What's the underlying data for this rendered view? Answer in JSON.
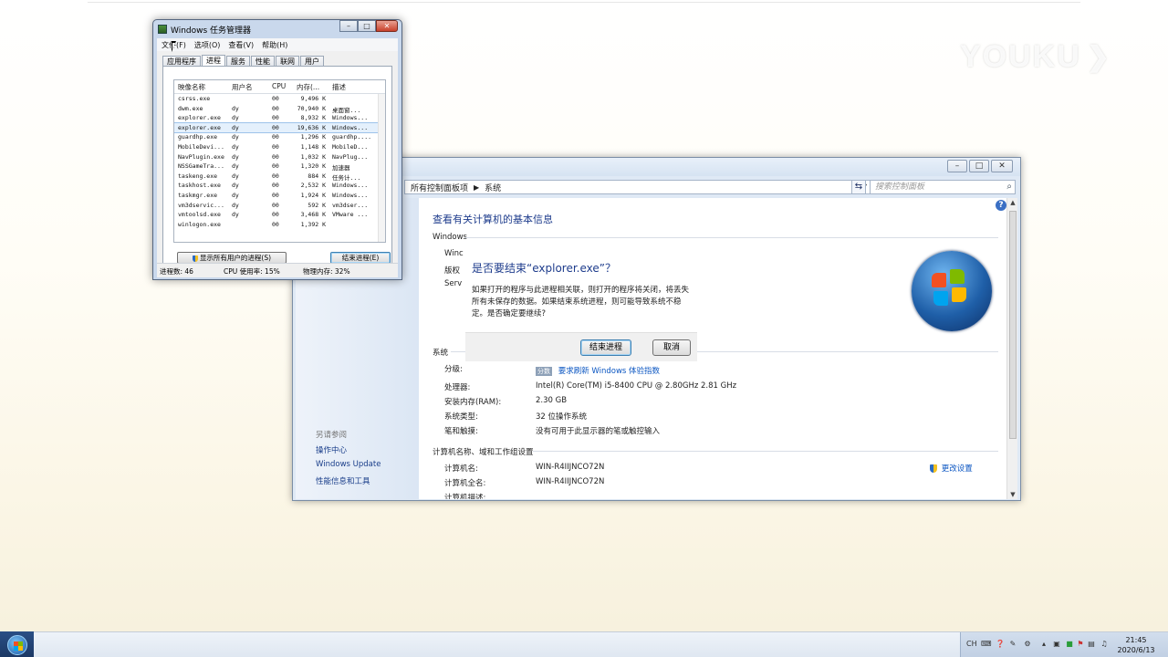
{
  "watermark": {
    "text": "YOUKU"
  },
  "system_window": {
    "address": {
      "segment1": "所有控制面板项",
      "segment2": "系统"
    },
    "search": {
      "placeholder": "搜索控制面板"
    },
    "page_title": "查看有关计算机的基本信息",
    "windows_edition_section": "Windows",
    "partial_labels": [
      "Winc",
      "版权",
      "Serv"
    ],
    "system_section": "系统",
    "rating": {
      "label": "分级:",
      "badge": "分数",
      "link": "要求刷新 Windows 体验指数"
    },
    "specs": [
      {
        "label": "处理器:",
        "value": "Intel(R) Core(TM) i5-8400 CPU @ 2.80GHz   2.81 GHz"
      },
      {
        "label": "安装内存(RAM):",
        "value": "2.30 GB"
      },
      {
        "label": "系统类型:",
        "value": "32 位操作系统"
      },
      {
        "label": "笔和触摸:",
        "value": "没有可用于此显示器的笔或触控输入"
      }
    ],
    "computer_section": "计算机名称、域和工作组设置",
    "computer": [
      {
        "label": "计算机名:",
        "value": "WIN-R4IIJNCO72N"
      },
      {
        "label": "计算机全名:",
        "value": "WIN-R4IIJNCO72N"
      },
      {
        "label": "计算机描述:",
        "value": ""
      }
    ],
    "change_settings": "更改设置",
    "left_pane": {
      "see_also": "另请参阅",
      "links": [
        "操作中心",
        "Windows Update",
        "性能信息和工具"
      ]
    }
  },
  "dialog": {
    "title": "是否要结束“explorer.exe”？",
    "message": "如果打开的程序与此进程相关联，则打开的程序将关闭，将丢失所有未保存的数据。如果结束系统进程，则可能导致系统不稳定。是否确定要继续?",
    "end_button": "结束进程",
    "cancel_button": "取消"
  },
  "task_manager": {
    "title": "Windows 任务管理器",
    "menus": [
      "文件(F)",
      "选项(O)",
      "查看(V)",
      "帮助(H)"
    ],
    "tabs": [
      "应用程序",
      "进程",
      "服务",
      "性能",
      "联网",
      "用户"
    ],
    "active_tab": 1,
    "columns": [
      "映像名称",
      "用户名",
      "CPU",
      "内存(...",
      "描述"
    ],
    "rows": [
      {
        "name": "csrss.exe",
        "user": "",
        "cpu": "00",
        "mem": "9,496 K",
        "desc": ""
      },
      {
        "name": "dwm.exe",
        "user": "dy",
        "cpu": "00",
        "mem": "70,940 K",
        "desc": "桌面窗..."
      },
      {
        "name": "explorer.exe",
        "user": "dy",
        "cpu": "00",
        "mem": "8,932 K",
        "desc": "Windows..."
      },
      {
        "name": "explorer.exe",
        "user": "dy",
        "cpu": "00",
        "mem": "19,636 K",
        "desc": "Windows...",
        "selected": true
      },
      {
        "name": "guardhp.exe",
        "user": "dy",
        "cpu": "00",
        "mem": "1,296 K",
        "desc": "guardhp...."
      },
      {
        "name": "MobileDevi...",
        "user": "dy",
        "cpu": "00",
        "mem": "1,148 K",
        "desc": "MobileD..."
      },
      {
        "name": "NavPlugin.exe",
        "user": "dy",
        "cpu": "00",
        "mem": "1,032 K",
        "desc": "NavPlug..."
      },
      {
        "name": "NSSGameTra...",
        "user": "dy",
        "cpu": "00",
        "mem": "1,320 K",
        "desc": "加速器"
      },
      {
        "name": "taskeng.exe",
        "user": "dy",
        "cpu": "00",
        "mem": "884 K",
        "desc": "任务计..."
      },
      {
        "name": "taskhost.exe",
        "user": "dy",
        "cpu": "00",
        "mem": "2,532 K",
        "desc": "Windows..."
      },
      {
        "name": "taskmgr.exe",
        "user": "dy",
        "cpu": "00",
        "mem": "1,924 K",
        "desc": "Windows..."
      },
      {
        "name": "vm3dservic...",
        "user": "dy",
        "cpu": "00",
        "mem": "592 K",
        "desc": "vm3dser..."
      },
      {
        "name": "vmtoolsd.exe",
        "user": "dy",
        "cpu": "00",
        "mem": "3,468 K",
        "desc": "VMware ..."
      },
      {
        "name": "winlogon.exe",
        "user": "",
        "cpu": "00",
        "mem": "1,392 K",
        "desc": ""
      }
    ],
    "show_all_button": "显示所有用户的进程(S)",
    "end_process_button": "结束进程(E)",
    "status": {
      "processes": "进程数: 46",
      "cpu": "CPU 使用率: 15%",
      "memory": "物理内存: 32%"
    }
  },
  "taskbar": {
    "tray_lang": "CH",
    "clock_time": "21:45",
    "clock_date": "2020/6/13"
  }
}
